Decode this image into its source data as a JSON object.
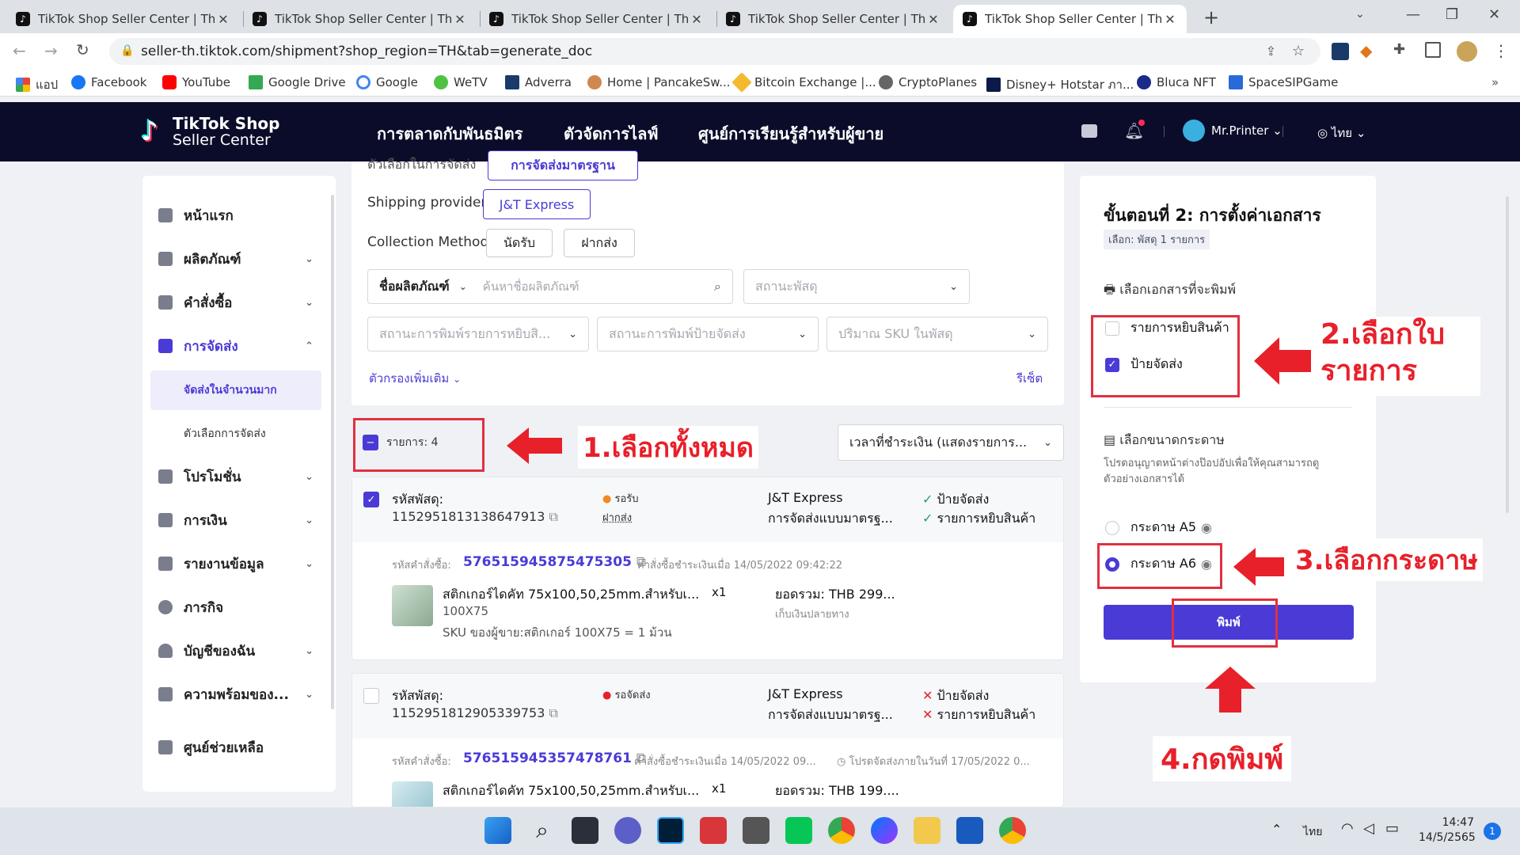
{
  "browser": {
    "tabs": [
      {
        "title": "TikTok Shop Seller Center | Thaila",
        "active": false
      },
      {
        "title": "TikTok Shop Seller Center | Thaila",
        "active": false
      },
      {
        "title": "TikTok Shop Seller Center | Thaila",
        "active": false
      },
      {
        "title": "TikTok Shop Seller Center | Thaila",
        "active": false
      },
      {
        "title": "TikTok Shop Seller Center | Thaila",
        "active": true
      }
    ],
    "url": "seller-th.tiktok.com/shipment?shop_region=TH&tab=generate_doc",
    "bookmarks": [
      "แอป",
      "Facebook",
      "YouTube",
      "Google Drive",
      "Google",
      "WeTV",
      "Adverra",
      "Home | PancakeSw...",
      "Bitcoin Exchange |...",
      "CryptoPlanes",
      "Disney+ Hotstar ภา...",
      "Bluca NFT",
      "SpaceSIPGame"
    ]
  },
  "header": {
    "logo_top": "TikTok Shop",
    "logo_bottom": "Seller Center",
    "nav": [
      "การตลาดกับพันธมิตร",
      "ตัวจัดการไลฟ์",
      "ศูนย์การเรียนรู้สำหรับผู้ขาย"
    ],
    "user": "Mr.Printer",
    "lang": "ไทย"
  },
  "sidebar": {
    "items": [
      {
        "label": "หน้าแรก",
        "chevron": ""
      },
      {
        "label": "ผลิตภัณฑ์",
        "chevron": "⌄"
      },
      {
        "label": "คำสั่งซื้อ",
        "chevron": "⌄"
      },
      {
        "label": "การจัดส่ง",
        "chevron": "⌃"
      },
      {
        "label": "โปรโมชั่น",
        "chevron": "⌄"
      },
      {
        "label": "การเงิน",
        "chevron": "⌄"
      },
      {
        "label": "รายงานข้อมูล",
        "chevron": "⌄"
      },
      {
        "label": "ภารกิจ",
        "chevron": ""
      },
      {
        "label": "บัญชีของฉัน",
        "chevron": "⌄"
      },
      {
        "label": "ความพร้อมของ...",
        "chevron": "⌄"
      },
      {
        "label": "ศูนย์ช่วยเหลือ",
        "chevron": ""
      }
    ],
    "sub": [
      "จัดส่งในจำนวนมาก",
      "ตัวเลือกการจัดส่ง"
    ]
  },
  "filters": {
    "top_cut_label": "ตัวเลือกในการจัดส่ง",
    "top_cut_btn": "การจัดส่งมาตรฐาน",
    "shipping_label": "Shipping provider",
    "shipping_btn": "J&T Express",
    "collection_label": "Collection Method",
    "collection_btns": [
      "นัดรับ",
      "ฝากส่ง"
    ],
    "product_select": "ชื่อผลิตภัณฑ์",
    "search_placeholder": "ค้นหาชื่อผลิตภัณฑ์",
    "status_parcel": "สถานะพัสดุ",
    "status_print_list": "สถานะการพิมพ์รายการหยิบสิ...",
    "status_print_label": "สถานะการพิมพ์ป้ายจัดส่ง",
    "sku_qty": "ปริมาณ SKU ในพัสดุ",
    "more_filters": "ตัวกรองเพิ่มเติม",
    "reset": "รีเซ็ต"
  },
  "list": {
    "count_label": "รายการ: 4",
    "sort": "เวลาที่ชำระเงิน (แสดงรายการ...",
    "orders": [
      {
        "parcel_label": "รหัสพัสดุ:",
        "parcel_id": "1152951813138647913",
        "status": "รอรับ",
        "status_sub": "ฝากส่ง",
        "carrier": "J&T Express",
        "carrier_sub": "การจัดส่งแบบมาตรฐ...",
        "doc1": "ป้ายจัดส่ง",
        "doc2": "รายการหยิบสินค้า",
        "doc_mark": "✓",
        "order_label": "รหัสคำสั่งซื้อ:",
        "order_id": "576515945875475305",
        "paid": "คำสั่งซื้อชำระเงินเมื่อ 14/05/2022 09:42:22",
        "note": "",
        "product": "สติกเกอร์ไดคัท 75x100,50,25mm.สำหรับเ...",
        "variant": "100X75",
        "sku": "SKU ของผู้ขาย:สติกเกอร์ 100X75 = 1 ม้วน",
        "qty": "x1",
        "total": "ยอดรวม: THB 299...",
        "pay": "เก็บเงินปลายทาง"
      },
      {
        "parcel_label": "รหัสพัสดุ:",
        "parcel_id": "1152951812905339753",
        "status": "รอจัดส่ง",
        "status_sub": "",
        "carrier": "J&T Express",
        "carrier_sub": "การจัดส่งแบบมาตรฐ...",
        "doc1": "ป้ายจัดส่ง",
        "doc2": "รายการหยิบสินค้า",
        "doc_mark": "✕",
        "order_label": "รหัสคำสั่งซื้อ:",
        "order_id": "576515945357478761",
        "paid": "คำสั่งซื้อชำระเงินเมื่อ 14/05/2022 09...",
        "note": "โปรดจัดส่งภายในวันที่ 17/05/2022 0...",
        "product": "สติกเกอร์ไดคัท 75x100,50,25mm.สำหรับเ...",
        "variant": "",
        "sku": "",
        "qty": "x1",
        "total": "ยอดรวม: THB 199....",
        "pay": ""
      }
    ]
  },
  "step2": {
    "title": "ขั้นตอนที่ 2: การตั้งค่าเอกสาร",
    "selected": "เลือก: พัสดุ 1 รายการ",
    "docs_title": "เลือกเอกสารที่จะพิมพ์",
    "doc_options": [
      {
        "label": "รายการหยิบสินค้า",
        "checked": false
      },
      {
        "label": "ป้ายจัดส่ง",
        "checked": true
      }
    ],
    "paper_title": "เลือกขนาดกระดาษ",
    "paper_hint": "โปรดอนุญาตหน้าต่างป๊อปอัปเพื่อให้คุณสามารถดูตัวอย่างเอกสารได้",
    "paper_options": [
      {
        "label": "กระดาษ A5",
        "checked": false
      },
      {
        "label": "กระดาษ A6",
        "checked": true
      }
    ],
    "print_btn": "พิมพ์"
  },
  "annotations": {
    "a1": "1.เลือกทั้งหมด",
    "a2_line1": "2.เลือกใบ",
    "a2_line2": "รายการ",
    "a3": "3.เลือกกระดาษ",
    "a4": "4.กดพิมพ์"
  },
  "taskbar": {
    "lang": "ไทย",
    "time": "14:47",
    "date": "14/5/2565",
    "badge": "1"
  }
}
